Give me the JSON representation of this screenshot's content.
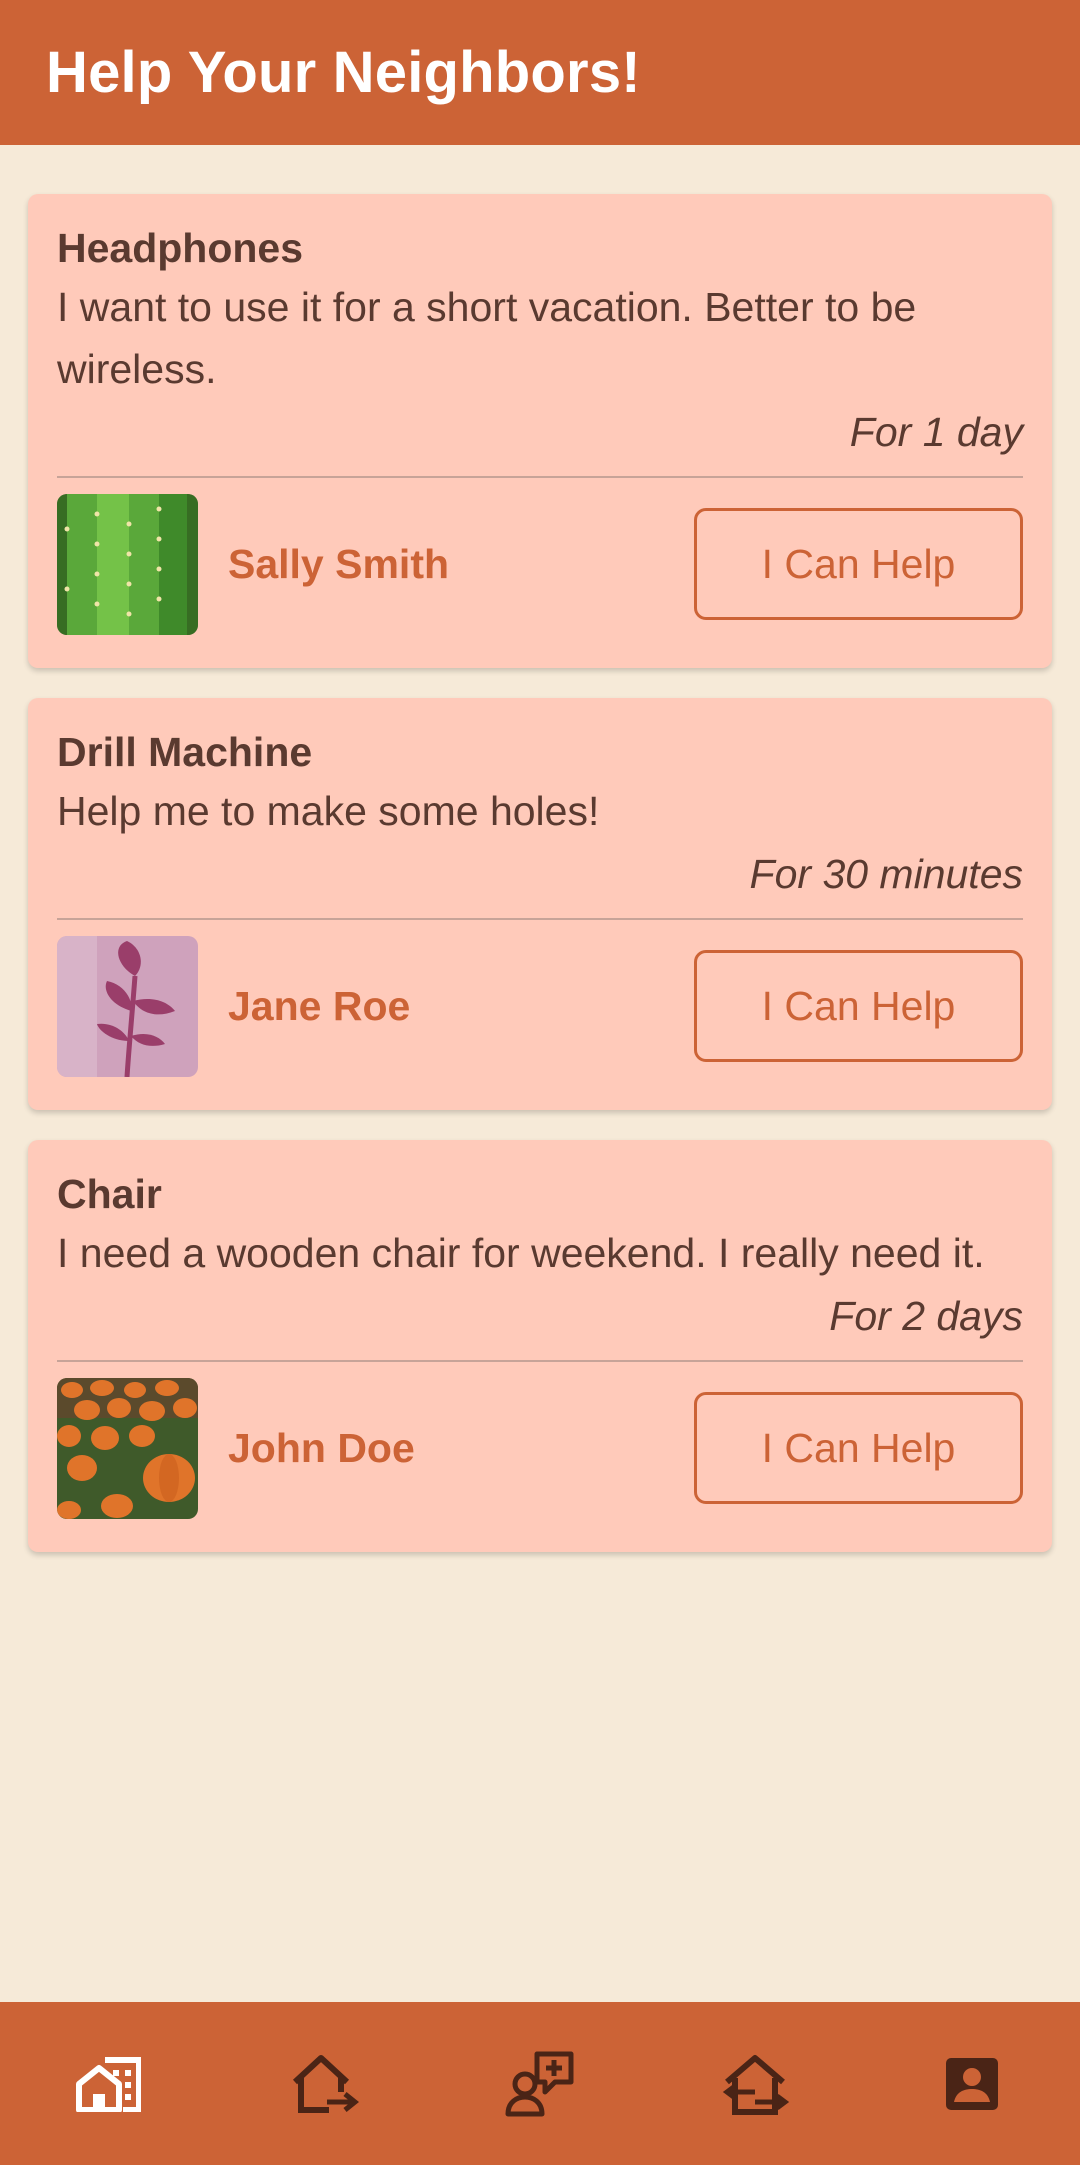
{
  "appbar": {
    "title": "Help Your Neighbors!"
  },
  "requests": [
    {
      "title": "Headphones",
      "description": "I want to use it for a short vacation. Better to be wireless.",
      "duration": "For 1 day",
      "user": "Sally Smith",
      "avatar": "cactus-photo",
      "button": "I Can Help"
    },
    {
      "title": "Drill Machine",
      "description": "Help me to make some holes!",
      "duration": "For 30 minutes",
      "user": "Jane Roe",
      "avatar": "plant-shadow-photo",
      "button": "I Can Help"
    },
    {
      "title": "Chair",
      "description": "I need a wooden chair for weekend. I really need it.",
      "duration": "For 2 days",
      "user": "John Doe",
      "avatar": "pumpkins-photo",
      "button": "I Can Help"
    }
  ],
  "bottom_nav": [
    {
      "icon": "home-work-icon",
      "active": true
    },
    {
      "icon": "house-arrow-out-icon",
      "active": false
    },
    {
      "icon": "person-add-request-icon",
      "active": false
    },
    {
      "icon": "house-exchange-icon",
      "active": false
    },
    {
      "icon": "account-box-icon",
      "active": false
    }
  ],
  "colors": {
    "primary": "#CC6336",
    "background": "#F6EAD8",
    "card": "#FFCABA",
    "text": "#5A3A30",
    "nav_active": "#FFFFFF",
    "nav_inactive": "#4A2416"
  }
}
